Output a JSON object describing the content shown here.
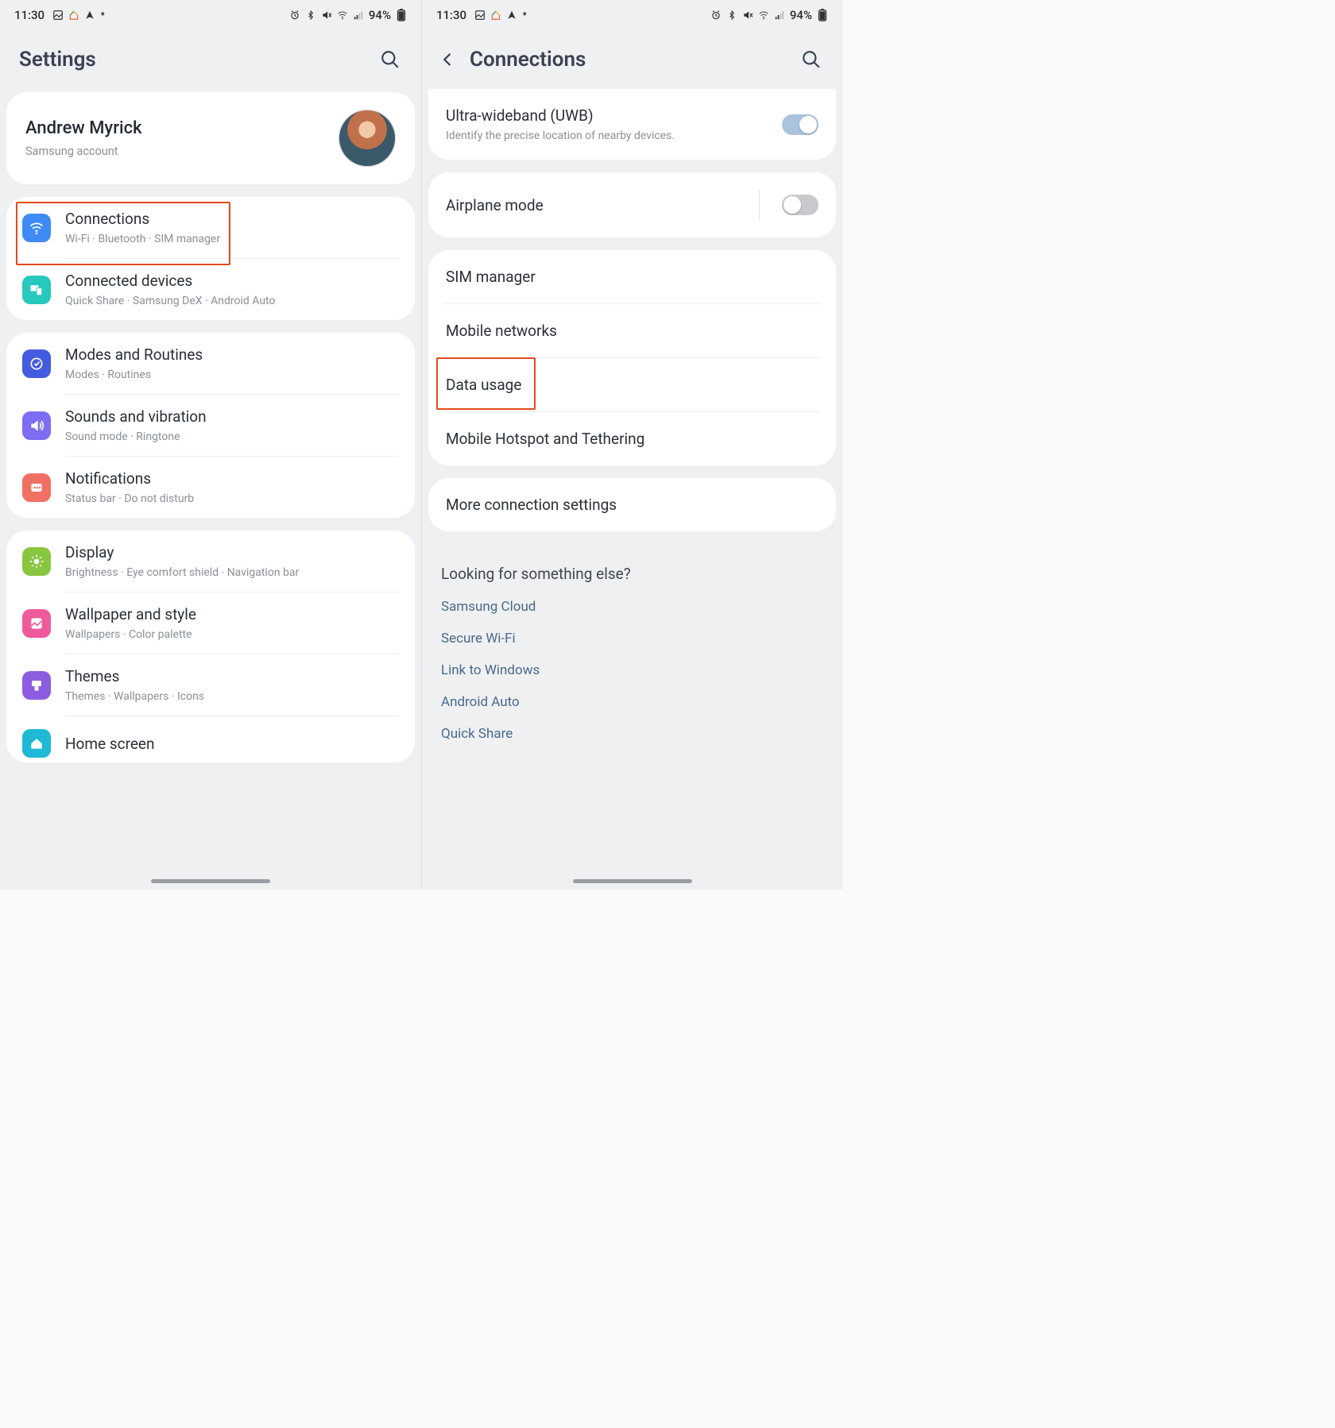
{
  "status": {
    "time": "11:30",
    "battery_text": "94%"
  },
  "left": {
    "title": "Settings",
    "account": {
      "name": "Andrew Myrick",
      "sub": "Samsung account"
    },
    "groups": [
      {
        "items": [
          {
            "key": "connections",
            "title": "Connections",
            "sub": "Wi-Fi  ·  Bluetooth  ·  SIM manager",
            "icon": "wifi-icon",
            "color": "bg-blue",
            "highlight": true
          },
          {
            "key": "connected-devices",
            "title": "Connected devices",
            "sub": "Quick Share  ·  Samsung DeX  ·  Android Auto",
            "icon": "devices-icon",
            "color": "bg-teal"
          }
        ]
      },
      {
        "items": [
          {
            "key": "modes-routines",
            "title": "Modes and Routines",
            "sub": "Modes  ·  Routines",
            "icon": "routines-icon",
            "color": "bg-indigo"
          },
          {
            "key": "sounds-vibration",
            "title": "Sounds and vibration",
            "sub": "Sound mode  ·  Ringtone",
            "icon": "sound-icon",
            "color": "bg-violet"
          },
          {
            "key": "notifications",
            "title": "Notifications",
            "sub": "Status bar  ·  Do not disturb",
            "icon": "notifications-icon",
            "color": "bg-coral"
          }
        ]
      },
      {
        "items": [
          {
            "key": "display",
            "title": "Display",
            "sub": "Brightness  ·  Eye comfort shield  ·  Navigation bar",
            "icon": "display-icon",
            "color": "bg-green"
          },
          {
            "key": "wallpaper",
            "title": "Wallpaper and style",
            "sub": "Wallpapers  ·  Color palette",
            "icon": "wallpaper-icon",
            "color": "bg-pink"
          },
          {
            "key": "themes",
            "title": "Themes",
            "sub": "Themes  ·  Wallpapers  ·  Icons",
            "icon": "themes-icon",
            "color": "bg-purple"
          },
          {
            "key": "home-screen",
            "title": "Home screen",
            "sub": "",
            "icon": "home-icon",
            "color": "bg-cyan"
          }
        ]
      }
    ]
  },
  "right": {
    "title": "Connections",
    "groups": [
      {
        "items": [
          {
            "key": "uwb",
            "title": "Ultra-wideband (UWB)",
            "sub": "Identify the precise location of nearby devices.",
            "toggle": "on"
          }
        ]
      },
      {
        "items": [
          {
            "key": "airplane",
            "title": "Airplane mode",
            "toggle": "off",
            "vline": true
          }
        ]
      },
      {
        "items": [
          {
            "key": "sim-manager",
            "title": "SIM manager"
          },
          {
            "key": "mobile-networks",
            "title": "Mobile networks"
          },
          {
            "key": "data-usage",
            "title": "Data usage",
            "highlight": true
          },
          {
            "key": "hotspot",
            "title": "Mobile Hotspot and Tethering"
          }
        ]
      },
      {
        "items": [
          {
            "key": "more-conn",
            "title": "More connection settings"
          }
        ]
      }
    ],
    "hint": {
      "title": "Looking for something else?",
      "links": [
        "Samsung Cloud",
        "Secure Wi-Fi",
        "Link to Windows",
        "Android Auto",
        "Quick Share"
      ]
    }
  }
}
